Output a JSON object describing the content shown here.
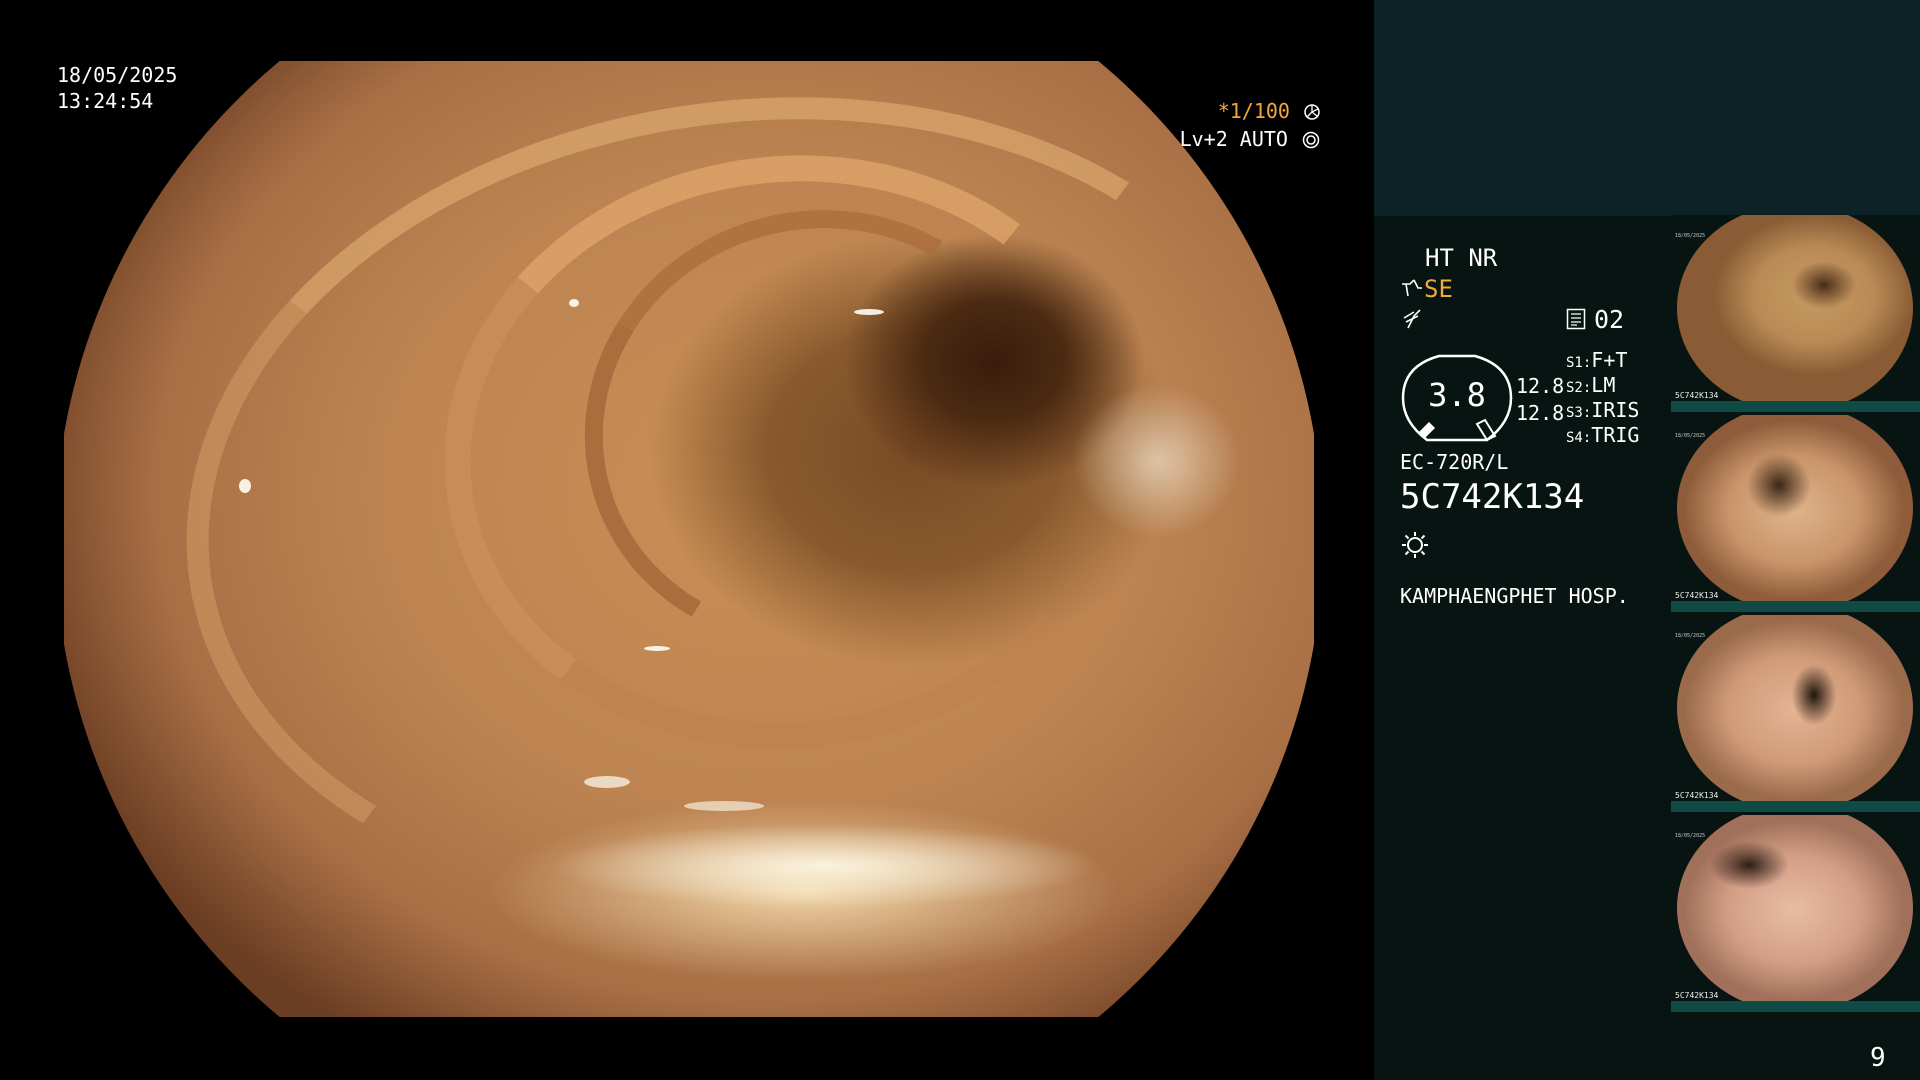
{
  "overlay": {
    "date": "18/05/2025",
    "time": "13:24:54",
    "shutter": "*1/100",
    "iris": "Lv+2 AUTO"
  },
  "info_panel": {
    "ht_nr": "HT NR",
    "se_label": "SE",
    "memory_number": "02",
    "gauge_value": "3.8",
    "value_a": "12.8",
    "value_b": "12.8",
    "switches": [
      {
        "key": "S1:",
        "value": "F+T"
      },
      {
        "key": "S2:",
        "value": "LM"
      },
      {
        "key": "S3:",
        "value": "IRIS"
      },
      {
        "key": "S4:",
        "value": "TRIG"
      }
    ],
    "scope_model": "EC-720R/L",
    "scope_serial": "5C742K134",
    "hospital": "KAMPHAENGPHET HOSP."
  },
  "thumbnails": [
    {
      "date": "18/05/2025",
      "serial": "5C742K134"
    },
    {
      "date": "18/05/2025",
      "serial": "5C742K134"
    },
    {
      "date": "18/05/2025",
      "serial": "5C742K134"
    },
    {
      "date": "18/05/2025",
      "serial": "5C742K134"
    }
  ],
  "page_number": "9",
  "colors": {
    "accent_orange": "#f2a93b",
    "panel_top": "#0d2226",
    "panel_bg": "#071412",
    "thumb_strip": "#0f4a44"
  },
  "icons": [
    "shutter-icon",
    "iris-icon",
    "se-icon",
    "bolt-icon",
    "memory-icon",
    "light-icon"
  ]
}
